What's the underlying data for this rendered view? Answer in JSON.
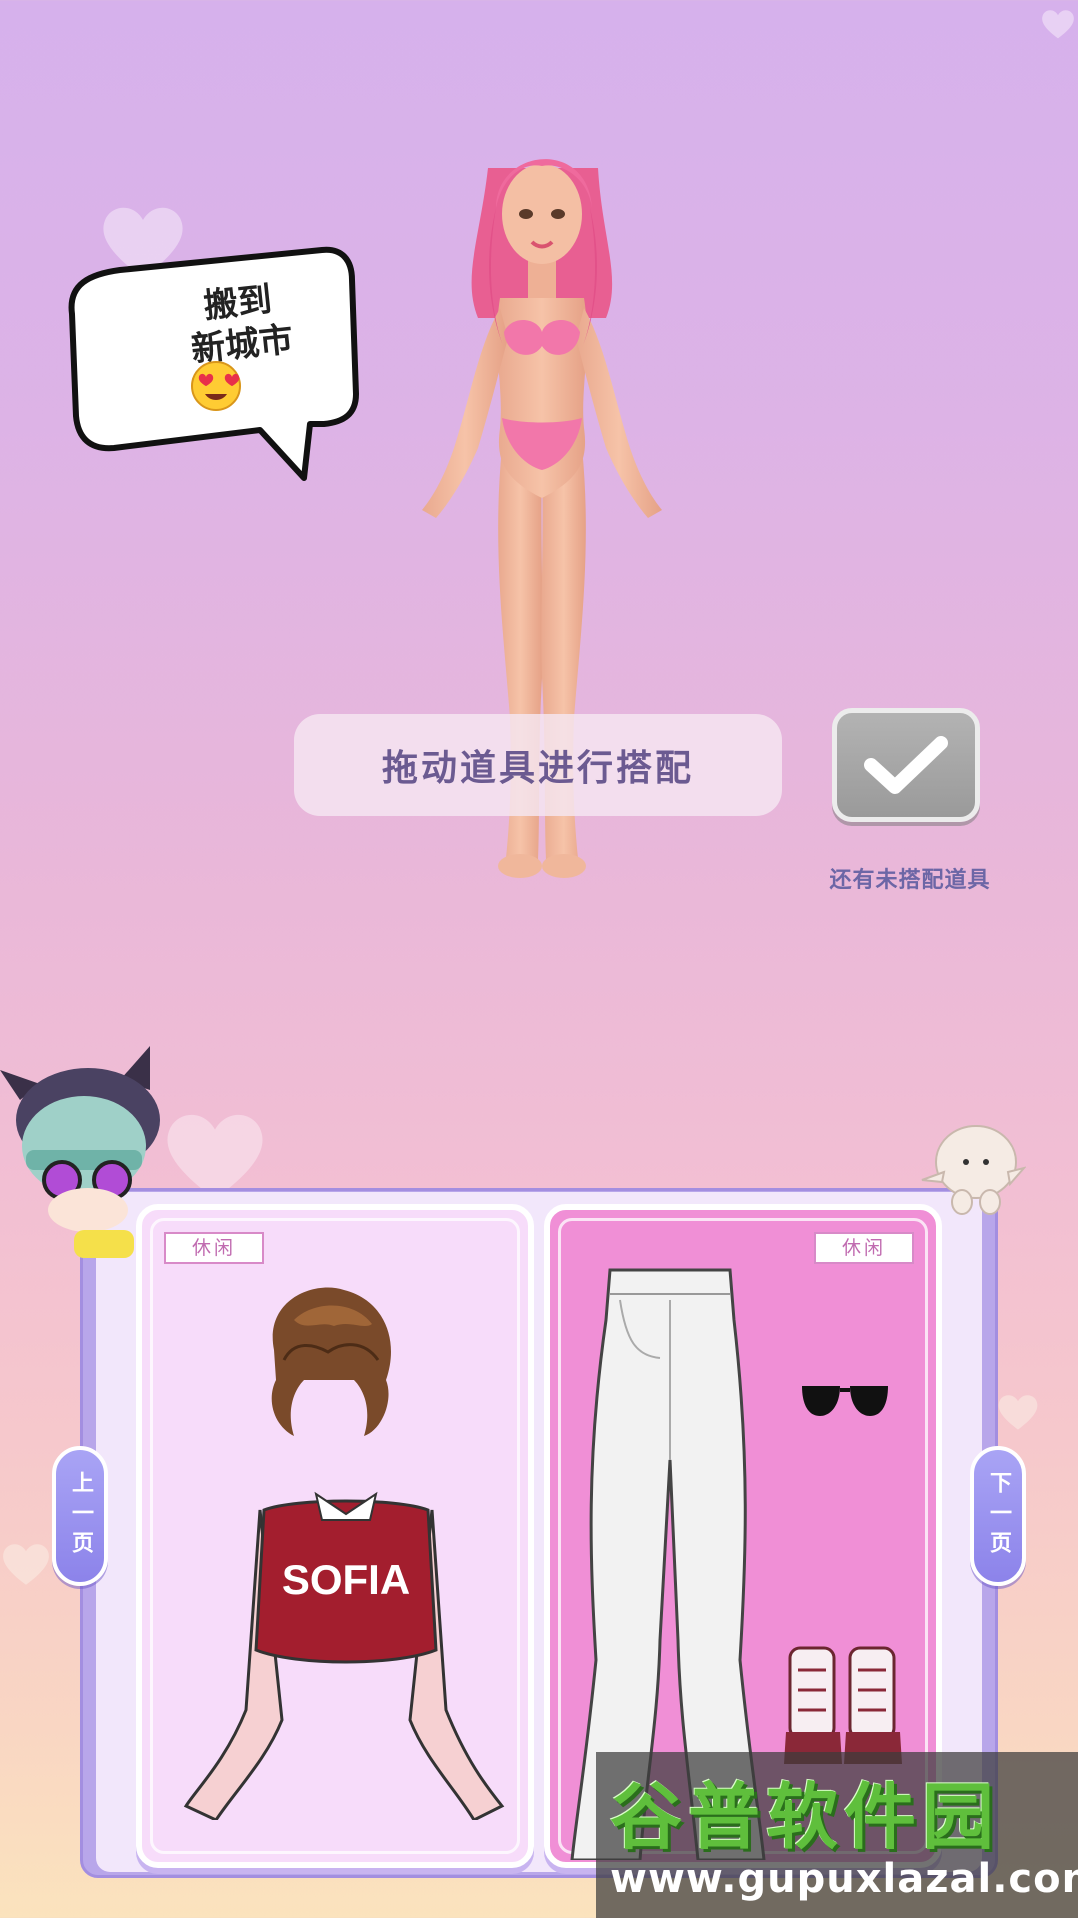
{
  "bubble": {
    "text_line1": "搬到",
    "text_line2": "新城市",
    "emoji": "heart-eyes-emoji"
  },
  "hint": {
    "text": "拖动道具进行搭配"
  },
  "confirm": {
    "icon": "checkmark-icon"
  },
  "status": {
    "text": "还有未搭配道具"
  },
  "wardrobe": {
    "left_card": {
      "tag": "休闲",
      "items": [
        {
          "icon": "brown-short-hair-icon"
        },
        {
          "icon": "sweater-icon",
          "print": "SOFIA"
        }
      ]
    },
    "right_card": {
      "tag": "休闲",
      "items": [
        {
          "icon": "white-flare-jeans-icon"
        },
        {
          "icon": "sunglasses-icon"
        },
        {
          "icon": "ankle-boots-icon"
        }
      ]
    }
  },
  "pager": {
    "prev_label": "上一页",
    "next_label": "下一页"
  },
  "watermark": {
    "title": "谷普软件园",
    "url": "www.gupuxlazal.com"
  },
  "colors": {
    "accent": "#8c83ea",
    "card_left_bg": "#f7dcfa",
    "card_right_bg": "#f08fd6",
    "hint_text": "#6b5a91"
  }
}
